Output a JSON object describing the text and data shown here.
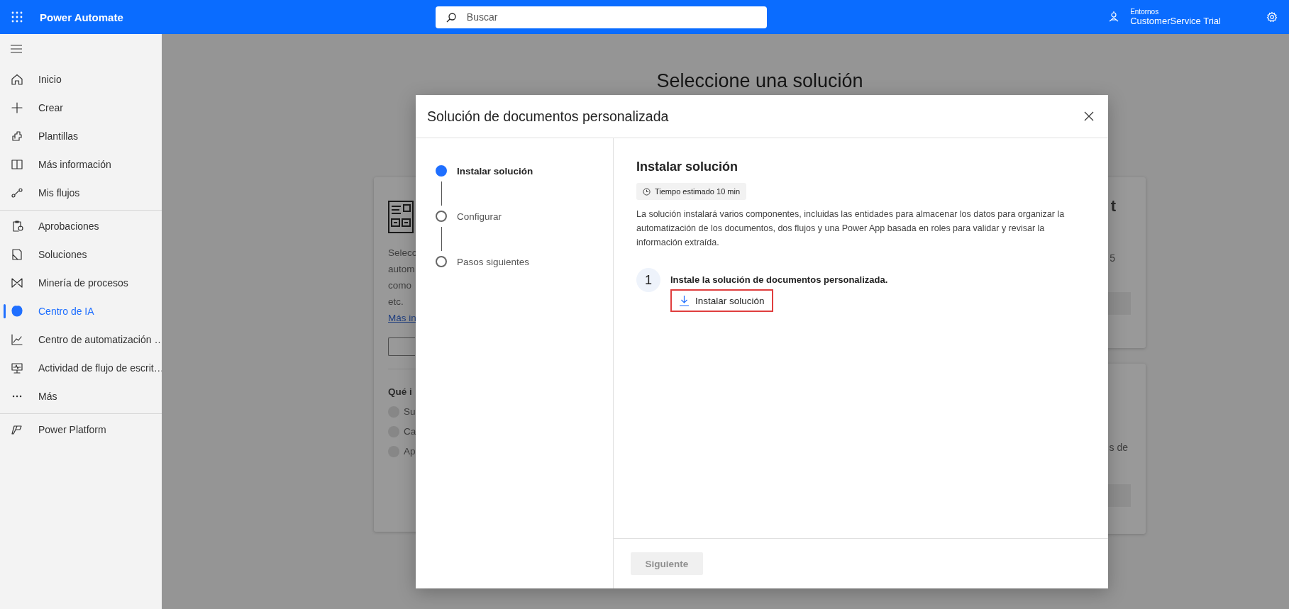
{
  "top_bar": {
    "app_name": "Power Automate",
    "search": {
      "placeholder": "Buscar"
    },
    "environment": {
      "label": "Entornos",
      "name": "CustomerService Trial"
    }
  },
  "sidebar": {
    "groups": [
      {
        "items": [
          {
            "label": "Inicio",
            "selected": false
          },
          {
            "label": "Crear",
            "selected": false
          },
          {
            "label": "Plantillas",
            "selected": false
          },
          {
            "label": "Más información",
            "selected": false
          },
          {
            "label": "Mis flujos",
            "selected": false
          }
        ]
      },
      {
        "items": [
          {
            "label": "Aprobaciones",
            "selected": false
          },
          {
            "label": "Soluciones",
            "selected": false
          },
          {
            "label": "Minería de procesos",
            "selected": false
          },
          {
            "label": "Centro de IA",
            "selected": true
          },
          {
            "label": "Centro de automatización …",
            "selected": false
          },
          {
            "label": "Actividad de flujo de escrit…",
            "selected": false
          },
          {
            "label": "Más",
            "selected": false
          }
        ]
      },
      {
        "items": [
          {
            "label": "Power Platform",
            "selected": false
          }
        ]
      }
    ]
  },
  "page": {
    "heading": "Seleccione una solución",
    "left_card": {
      "text_lines": [
        "Selecc",
        "autom",
        "como",
        "etc."
      ],
      "link": "Más in",
      "section_title": "Qué i",
      "options": [
        {
          "label": "Su",
          "selected": false
        },
        {
          "label": "Ca",
          "selected": false
        },
        {
          "label": "Ap",
          "selected": false
        }
      ]
    },
    "right_cards": [
      {
        "title": "t",
        "text": "5"
      },
      {
        "text": "s de"
      }
    ]
  },
  "dialog": {
    "title": "Solución de documentos personalizada",
    "steps": [
      {
        "label": "Instalar solución",
        "selected": true
      },
      {
        "label": "Configurar",
        "selected": false
      },
      {
        "label": "Pasos siguientes",
        "selected": false
      }
    ],
    "section_title": "Instalar solución",
    "time_badge": "Tiempo estimado 10 min",
    "description": "La solución instalará varios componentes, incluidas las entidades para almacenar los datos para organizar la automatización de los documentos, dos flujos y una Power App basada en roles para validar y revisar la información extraída.",
    "tasks": [
      {
        "number": "1",
        "text": "Instale la solución de documentos personalizada.",
        "action": "Instalar solución",
        "highlighted": true
      }
    ],
    "next_button": {
      "label": "Siguiente",
      "disabled": true
    }
  }
}
